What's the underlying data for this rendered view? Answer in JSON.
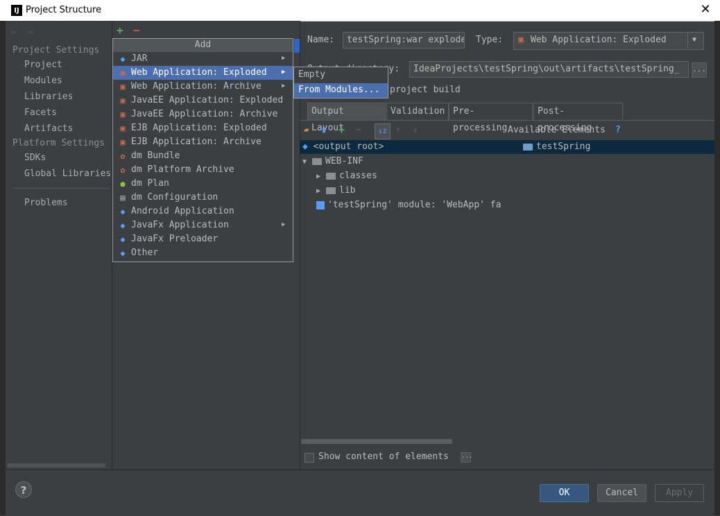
{
  "window": {
    "title": "Project Structure",
    "close_glyph": "✕",
    "logo": "IJ"
  },
  "nav": {
    "back_icon": "◆",
    "forward_icon": "◆",
    "project_settings_header": "Project Settings",
    "project_settings_items": [
      "Project",
      "Modules",
      "Libraries",
      "Facets",
      "Artifacts"
    ],
    "platform_settings_header": "Platform Settings",
    "platform_settings_items": [
      "SDKs",
      "Global Libraries"
    ],
    "problems": "Problems"
  },
  "middle": {
    "add_glyph": "+",
    "remove_glyph": "−"
  },
  "add_menu": {
    "header": "Add",
    "items": [
      {
        "label": "JAR",
        "icon": "jar-icon",
        "submenu": true
      },
      {
        "label": "Web Application: Exploded",
        "icon": "web-app-icon",
        "submenu": true,
        "selected": true
      },
      {
        "label": "Web Application: Archive",
        "icon": "web-app-icon",
        "submenu": true
      },
      {
        "label": "JavaEE Application: Exploded",
        "icon": "javaee-icon"
      },
      {
        "label": "JavaEE Application: Archive",
        "icon": "javaee-icon"
      },
      {
        "label": "EJB Application: Exploded",
        "icon": "ejb-icon"
      },
      {
        "label": "EJB Application: Archive",
        "icon": "ejb-icon"
      },
      {
        "label": "dm Bundle",
        "icon": "dm-bundle-icon"
      },
      {
        "label": "dm Platform Archive",
        "icon": "dm-platform-icon"
      },
      {
        "label": "dm Plan",
        "icon": "dm-plan-icon"
      },
      {
        "label": "dm Configuration",
        "icon": "dm-config-icon"
      },
      {
        "label": "Android Application",
        "icon": "android-icon"
      },
      {
        "label": "JavaFx Application",
        "icon": "javafx-icon",
        "submenu": true
      },
      {
        "label": "JavaFx Preloader",
        "icon": "javafx-icon"
      },
      {
        "label": "Other",
        "icon": "other-icon"
      }
    ],
    "submenu_glyph": "▶"
  },
  "submenu": {
    "items": [
      "Empty",
      "From Modules..."
    ]
  },
  "artifact": {
    "name_label": "Name:",
    "name_value": "testSpring:war exploded",
    "type_label": "Type:",
    "type_value": "Web Application: Exploded",
    "dropdown_glyph": "▼",
    "output_label": "Output directory:",
    "output_value": "IdeaProjects\\testSpring\\out\\artifacts\\testSpring_",
    "browse_glyph": "...",
    "include_label": "project build"
  },
  "tabs": [
    "Output Layout",
    "Validation",
    "Pre-processing",
    "Post-processing"
  ],
  "layout_tree": {
    "available_elements_label": "Available Elements",
    "help_glyph": "?",
    "output_root": "<output root>",
    "webinf": "WEB-INF",
    "classes": "classes",
    "lib": "lib",
    "module_facet": "'testSpring' module: 'WebApp' fa",
    "available_item": "testSpring"
  },
  "show_content_label": "Show content of elements",
  "show_content_btn": "...",
  "buttons": {
    "help": "?",
    "ok": "OK",
    "cancel": "Cancel",
    "apply": "Apply"
  },
  "colors": {
    "background": "#3c3f41",
    "selection": "#4b6eaf",
    "tree_selection": "#0d293e",
    "add_green": "#59a869",
    "remove_red": "#c75450"
  }
}
